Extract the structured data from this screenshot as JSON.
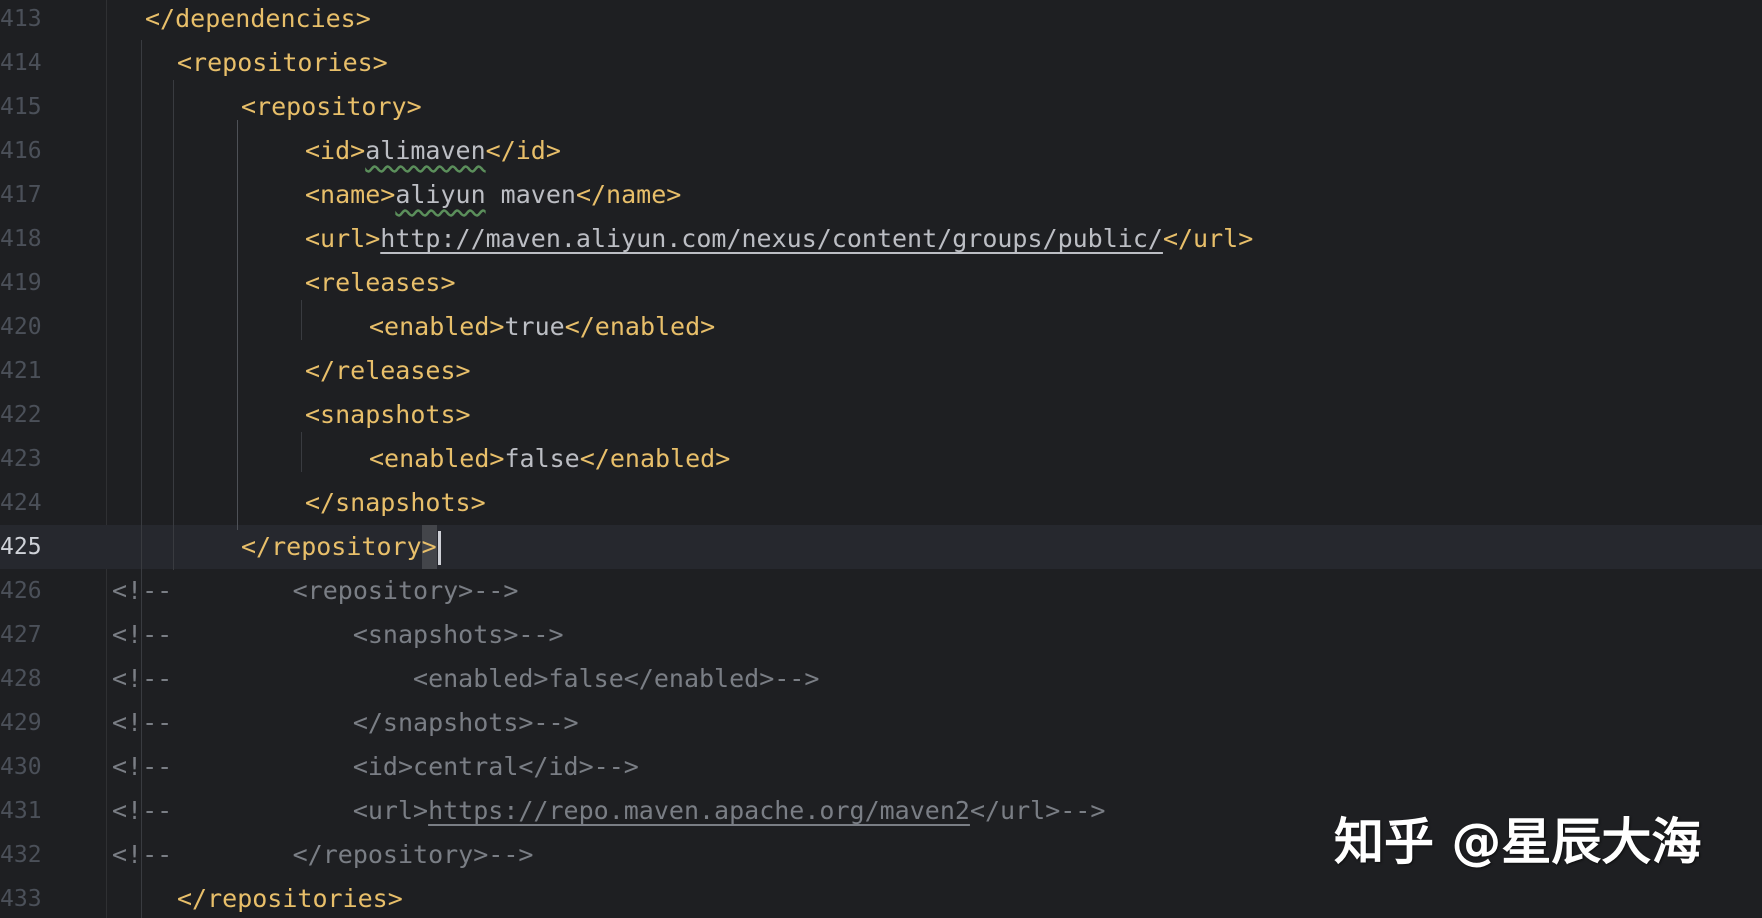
{
  "editor": {
    "lines": [
      {
        "num": "413",
        "parts": [
          {
            "k": "tag",
            "t": "</dependencies>"
          }
        ]
      },
      {
        "num": "414",
        "parts": [
          {
            "k": "tag",
            "t": "<repositories>"
          }
        ]
      },
      {
        "num": "415",
        "parts": [
          {
            "k": "tag",
            "t": "<repository>"
          }
        ]
      },
      {
        "num": "416",
        "parts": [
          {
            "k": "tag",
            "t": "<id>"
          },
          {
            "k": "txt sq",
            "t": "alimaven"
          },
          {
            "k": "tag",
            "t": "</id>"
          }
        ]
      },
      {
        "num": "417",
        "parts": [
          {
            "k": "tag",
            "t": "<name>"
          },
          {
            "k": "txt sq",
            "t": "aliyun"
          },
          {
            "k": "txt",
            "t": " maven"
          },
          {
            "k": "tag",
            "t": "</name>"
          }
        ]
      },
      {
        "num": "418",
        "parts": [
          {
            "k": "tag",
            "t": "<url>"
          },
          {
            "k": "txt lnk",
            "t": "http://maven.aliyun.com/nexus/content/groups/public/"
          },
          {
            "k": "tag",
            "t": "</url>"
          }
        ]
      },
      {
        "num": "419",
        "parts": [
          {
            "k": "tag",
            "t": "<releases>"
          }
        ]
      },
      {
        "num": "420",
        "parts": [
          {
            "k": "tag",
            "t": "<enabled>"
          },
          {
            "k": "txt",
            "t": "true"
          },
          {
            "k": "tag",
            "t": "</enabled>"
          }
        ]
      },
      {
        "num": "421",
        "parts": [
          {
            "k": "tag",
            "t": "</releases>"
          }
        ]
      },
      {
        "num": "422",
        "parts": [
          {
            "k": "tag",
            "t": "<snapshots>"
          }
        ]
      },
      {
        "num": "423",
        "parts": [
          {
            "k": "tag",
            "t": "<enabled>"
          },
          {
            "k": "txt",
            "t": "false"
          },
          {
            "k": "tag",
            "t": "</enabled>"
          }
        ]
      },
      {
        "num": "424",
        "parts": [
          {
            "k": "tag",
            "t": "</snapshots>"
          }
        ]
      },
      {
        "num": "425",
        "parts": [
          {
            "k": "tag",
            "t": "</repository"
          },
          {
            "k": "brace",
            "t": ">"
          }
        ]
      },
      {
        "num": "426",
        "parts": [
          {
            "k": "cmt",
            "t": "<!--        <repository>-->"
          }
        ]
      },
      {
        "num": "427",
        "parts": [
          {
            "k": "cmt",
            "t": "<!--            <snapshots>-->"
          }
        ]
      },
      {
        "num": "428",
        "parts": [
          {
            "k": "cmt",
            "t": "<!--                <enabled>false</enabled>-->"
          }
        ]
      },
      {
        "num": "429",
        "parts": [
          {
            "k": "cmt",
            "t": "<!--            </snapshots>-->"
          }
        ]
      },
      {
        "num": "430",
        "parts": [
          {
            "k": "cmt",
            "t": "<!--            <id>central</id>-->"
          }
        ]
      },
      {
        "num": "431",
        "parts": [
          {
            "k": "cmt",
            "t": "<!--            <url>"
          },
          {
            "k": "cmt lnk",
            "t": "https://repo.maven.apache.org/maven2"
          },
          {
            "k": "cmt",
            "t": "</url>-->"
          }
        ]
      },
      {
        "num": "432",
        "parts": [
          {
            "k": "cmt",
            "t": "<!--        </repository>-->"
          }
        ]
      },
      {
        "num": "433",
        "parts": [
          {
            "k": "tag",
            "t": "</repositories>"
          }
        ]
      }
    ]
  },
  "watermark": {
    "text": "知乎 @星辰大海"
  }
}
